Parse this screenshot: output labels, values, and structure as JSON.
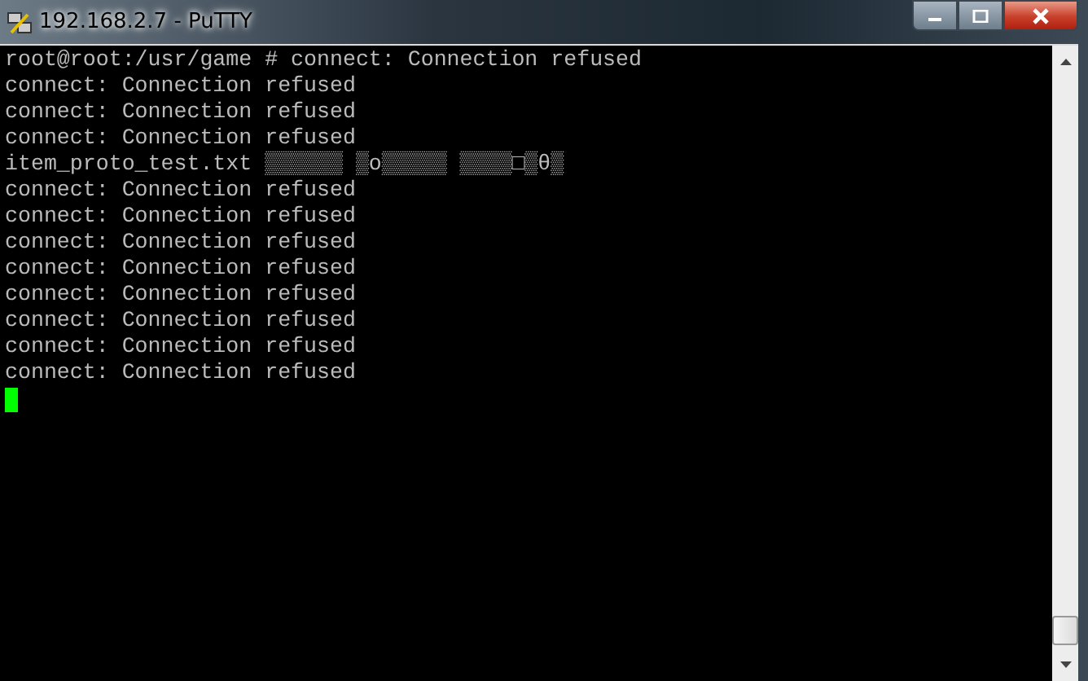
{
  "window": {
    "title": "192.168.2.7 - PuTTY"
  },
  "terminal": {
    "lines": [
      "root@root:/usr/game # connect: Connection refused",
      "connect: Connection refused",
      "connect: Connection refused",
      "connect: Connection refused",
      "item_proto_test.txt ▒▒▒▒▒▒ ▒o▒▒▒▒▒ ▒▒▒▒□▒θ▒",
      "connect: Connection refused",
      "connect: Connection refused",
      "connect: Connection refused",
      "connect: Connection refused",
      "connect: Connection refused",
      "connect: Connection refused",
      "connect: Connection refused",
      "connect: Connection refused"
    ],
    "cursor": true
  }
}
